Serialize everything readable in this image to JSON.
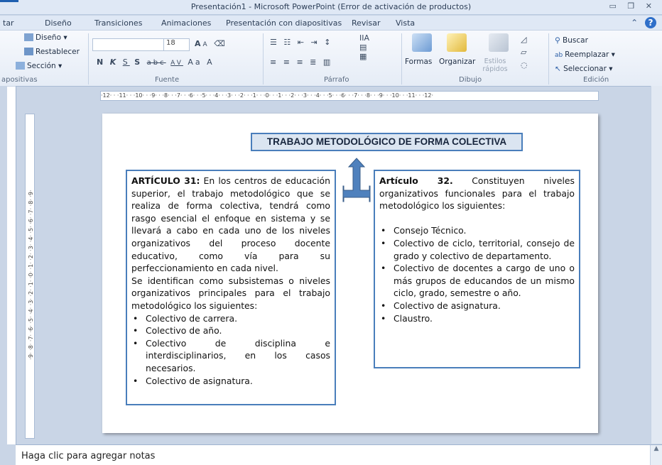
{
  "window": {
    "title": "Presentación1 - Microsoft PowerPoint (Error de activación de productos)",
    "controls": "▭ ❐ ✕"
  },
  "tabs": [
    {
      "label": "tar"
    },
    {
      "label": "Diseño"
    },
    {
      "label": "Transiciones"
    },
    {
      "label": "Animaciones"
    },
    {
      "label": "Presentación con diapositivas"
    },
    {
      "label": "Revisar"
    },
    {
      "label": "Vista"
    }
  ],
  "help": {
    "minimize": "⌃",
    "question": "?"
  },
  "ribbon": {
    "slides_group": {
      "label": "apositivas",
      "layout": "Diseño ▾",
      "reset": "Restablecer",
      "section": "Sección ▾"
    },
    "font_group": {
      "label": "Fuente",
      "font_name": "",
      "font_size": "18",
      "bold": "N",
      "italic": "K",
      "underline": "S",
      "strike": "S",
      "abc": "abc",
      "spacing": "AV",
      "case": "Aa",
      "grow": "A",
      "shrink": "A"
    },
    "paragraph_group": {
      "label": "Párrafo"
    },
    "drawing_group": {
      "label": "Dibujo",
      "shapes": "Formas",
      "arrange": "Organizar",
      "styles": "Estilos rápidos"
    },
    "editing_group": {
      "label": "Edición",
      "find": "Buscar",
      "replace": "Reemplazar ▾",
      "select": "Seleccionar ▾"
    }
  },
  "rulers": {
    "horizontal": "·12· · ·11· · ·10· · ·9· · ·8· · ·7· · ·6· · ·5· · ·4· · ·3· · ·2· · ·1· · ·0· · ·1· · ·2· · ·3· · ·4· · ·5· · ·6· · ·7· · ·8· · ·9· · ·10· · ·11· · ·12·",
    "vertical": "·9· ·8· ·7· ·6· ·5· ·4· ·3· ·2· ·1· ·0· ·1· ·2· ·3· ·4· ·5· ·6· ·7· ·8· ·9·"
  },
  "slide": {
    "title": "TRABAJO METODOLÓGICO DE FORMA COLECTIVA",
    "art31": {
      "heading": "ARTÍCULO 31:",
      "body": "En los centros de educación superior, el trabajo metodológico que se realiza de forma colectiva, tendrá como rasgo esencial el enfoque en sistema y se llevará a cabo en cada uno de los niveles organizativos del proceso docente educativo, como vía para su perfeccionamiento en cada nivel.",
      "body2": "Se identifican como subsistemas o niveles organizativos principales para el trabajo metodológico los siguientes:",
      "items": [
        "Colectivo de carrera.",
        "Colectivo de año.",
        "Colectivo de disciplina e interdisciplinarios, en los casos necesarios.",
        "Colectivo de asignatura."
      ]
    },
    "art32": {
      "heading": "Artículo 32.",
      "body": "Constituyen niveles organizativos funcionales para el trabajo metodológico los siguientes:",
      "items": [
        "Consejo Técnico.",
        "Colectivo de ciclo, territorial, consejo de grado y colectivo de departamento.",
        "Colectivo de docentes a cargo de uno o más grupos de educandos de un mismo ciclo, grado, semestre o año.",
        "Colectivo de asignatura.",
        "Claustro."
      ]
    }
  },
  "notes": {
    "placeholder": "Haga clic para agregar notas"
  },
  "colors": {
    "accent_border": "#4a7ebb",
    "title_fill": "#dbe5f1"
  }
}
